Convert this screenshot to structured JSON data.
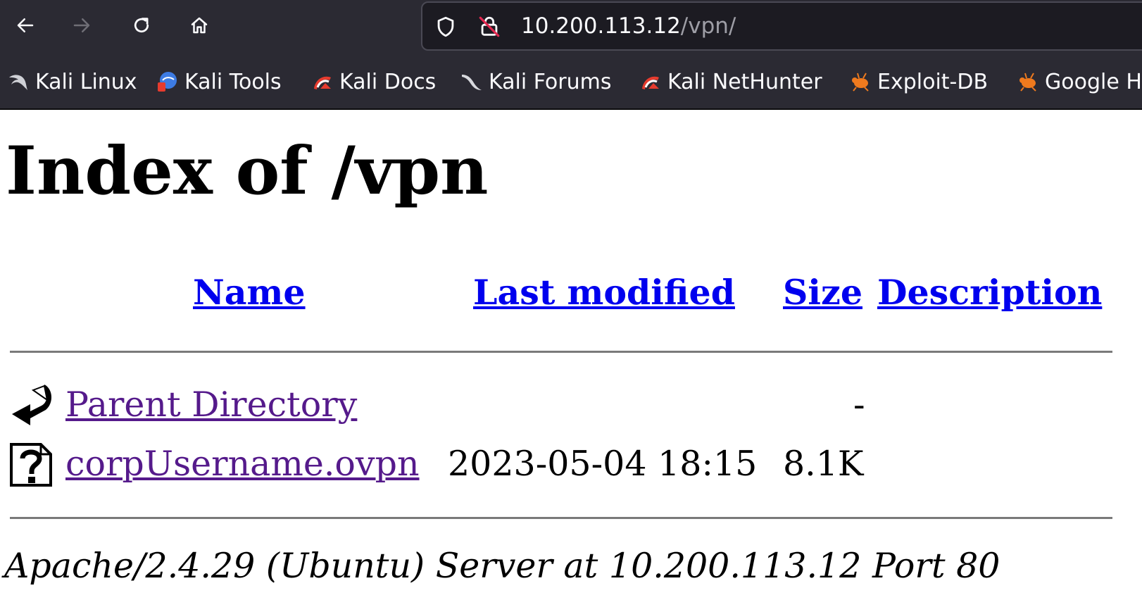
{
  "browser": {
    "url": {
      "host": "10.200.113.12",
      "path": "/vpn/"
    },
    "bookmarks": [
      {
        "label": "Kali Linux",
        "icon": "kali-dragon-icon"
      },
      {
        "label": "Kali Tools",
        "icon": "kali-tools-icon"
      },
      {
        "label": "Kali Docs",
        "icon": "kali-docs-icon"
      },
      {
        "label": "Kali Forums",
        "icon": "kali-forums-icon"
      },
      {
        "label": "Kali NetHunter",
        "icon": "kali-nethunter-icon"
      },
      {
        "label": "Exploit-DB",
        "icon": "exploit-db-icon"
      },
      {
        "label": "Google H",
        "icon": "google-hacking-icon"
      }
    ],
    "colors": {
      "toolbar_bg": "#2b2a33",
      "urlbar_bg": "#1c1b22",
      "text": "#fbfbfe"
    }
  },
  "page": {
    "title": "Index of /vpn",
    "columns": {
      "name": "Name",
      "last_modified": "Last modified",
      "size": "Size",
      "description": "Description"
    },
    "rows": [
      {
        "icon": "back-arrow-icon",
        "name": "Parent Directory",
        "last_modified": "",
        "size": "-",
        "description": ""
      },
      {
        "icon": "unknown-file-icon",
        "name": "corpUsername.ovpn",
        "last_modified": "2023-05-04 18:15",
        "size": "8.1K",
        "description": ""
      }
    ],
    "footer": "Apache/2.4.29 (Ubuntu) Server at 10.200.113.12 Port 80",
    "colors": {
      "link": "#0000ee",
      "visited_link": "#551a8b"
    }
  }
}
